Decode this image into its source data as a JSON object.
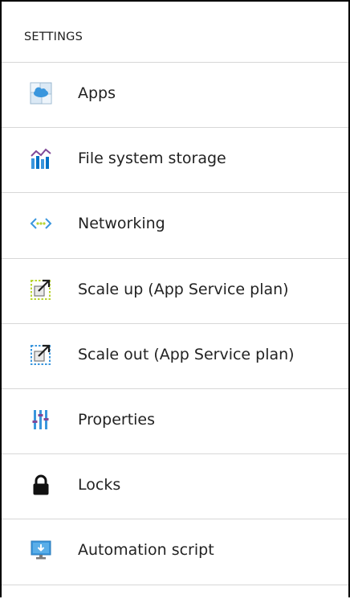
{
  "panel": {
    "section_title": "SETTINGS",
    "items": [
      {
        "label": "Apps",
        "icon": "apps-icon"
      },
      {
        "label": "File system storage",
        "icon": "storage-chart-icon"
      },
      {
        "label": "Networking",
        "icon": "networking-icon"
      },
      {
        "label": "Scale up (App Service plan)",
        "icon": "scale-up-icon"
      },
      {
        "label": "Scale out (App Service plan)",
        "icon": "scale-out-icon"
      },
      {
        "label": "Properties",
        "icon": "properties-icon"
      },
      {
        "label": "Locks",
        "icon": "lock-icon"
      },
      {
        "label": "Automation script",
        "icon": "automation-script-icon"
      }
    ]
  },
  "colors": {
    "accent_blue": "#3a96dd",
    "purple": "#804998",
    "lime": "#b8d432",
    "divider": "#d7d7d7"
  }
}
